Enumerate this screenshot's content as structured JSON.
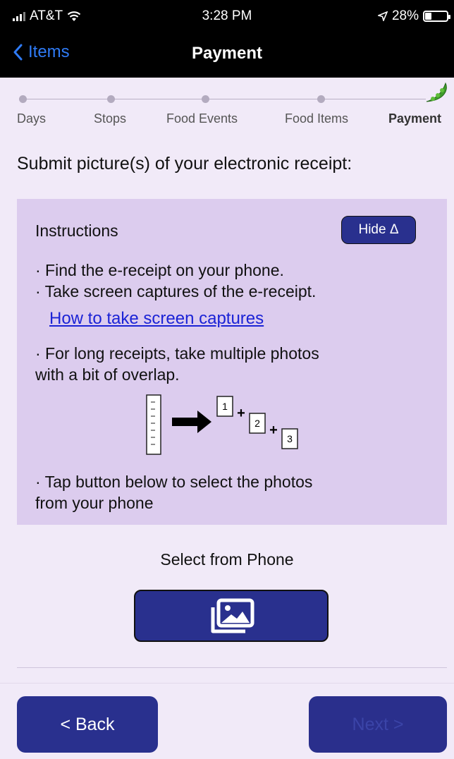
{
  "status_bar": {
    "carrier": "AT&T",
    "time": "3:28 PM",
    "battery": "28%"
  },
  "nav": {
    "back_label": "Items",
    "title": "Payment"
  },
  "steps": [
    {
      "label": "Days",
      "active": false
    },
    {
      "label": "Stops",
      "active": false
    },
    {
      "label": "Food Events",
      "active": false
    },
    {
      "label": "Food Items",
      "active": false
    },
    {
      "label": "Payment",
      "active": true
    }
  ],
  "heading": "Submit picture(s) of your electronic receipt:",
  "instructions": {
    "title": "Instructions",
    "hide_label": "Hide Δ",
    "bullet_1": "· Find the e-receipt on your phone.",
    "bullet_2": "· Take screen captures of the e-receipt.",
    "link": "How to take screen captures",
    "bullet_3_line_1": "· For long receipts, take multiple photos",
    "bullet_3_line_2": "with a bit of overlap.",
    "diagram": {
      "n1": "1",
      "n2": "2",
      "n3": "3",
      "plus": "+"
    },
    "bullet_4_line_1": "· Tap button below to select the photos",
    "bullet_4_line_2": "from your phone"
  },
  "select": {
    "label": "Select from Phone",
    "icon": "photo-gallery-icon"
  },
  "footer": {
    "back_label": "< Back",
    "next_label": "Next >"
  },
  "colors": {
    "accent": "#29308e",
    "panel": "#dcccee",
    "background": "#f1eaf8",
    "link": "#1b23d6",
    "ios_blue": "#2f7bf6"
  }
}
